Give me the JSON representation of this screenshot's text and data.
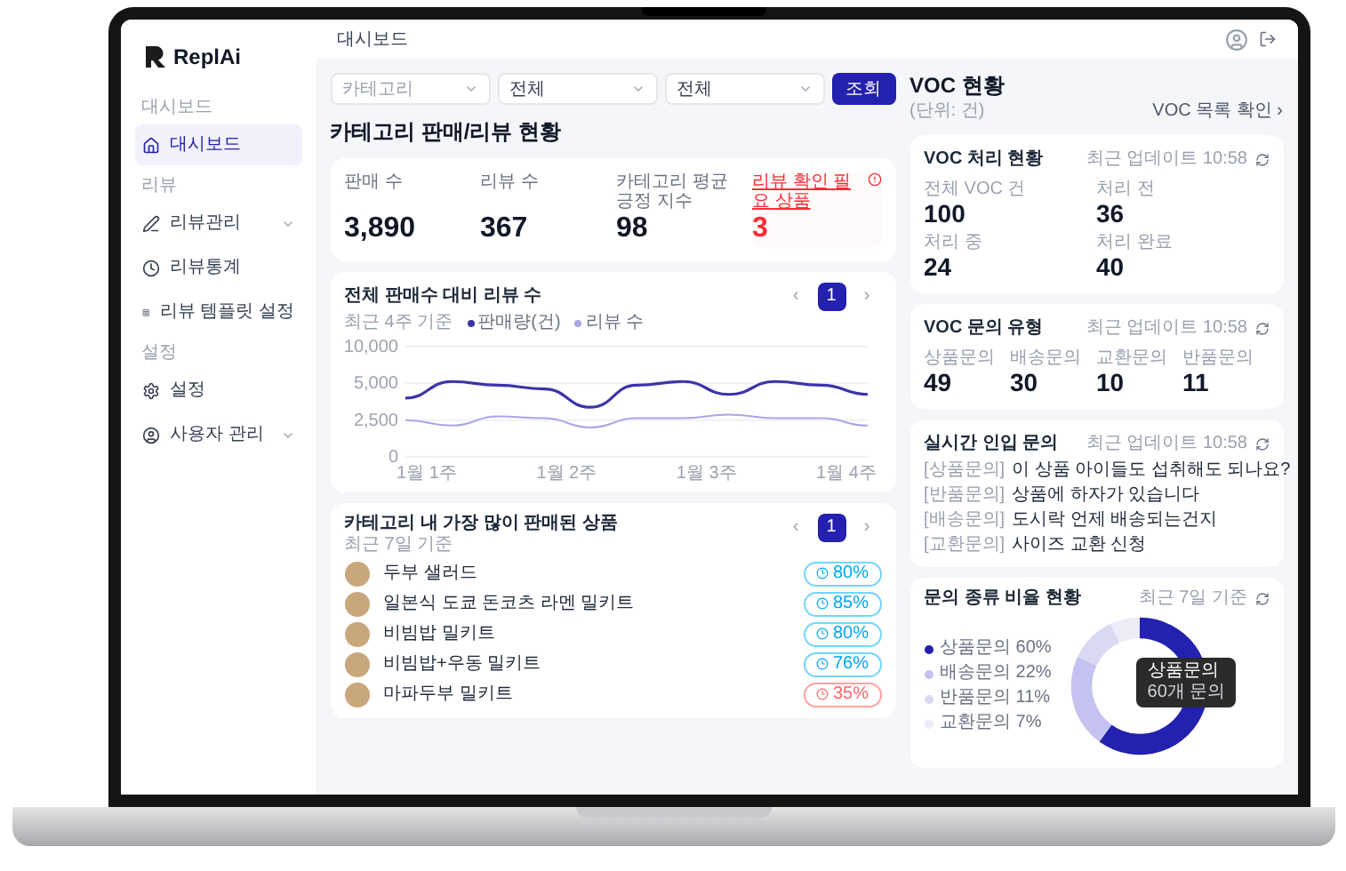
{
  "sidebar": {
    "logo": "ReplAi",
    "sections": [
      {
        "heading": "대시보드",
        "items": [
          {
            "label": "대시보드",
            "kind": "home",
            "selected": true,
            "expandable": false
          }
        ]
      },
      {
        "heading": "리뷰",
        "items": [
          {
            "label": "리뷰관리",
            "kind": "pen",
            "selected": false,
            "expandable": true
          },
          {
            "label": "리뷰통계",
            "kind": "clock",
            "selected": false,
            "expandable": false
          },
          {
            "label": "리뷰 템플릿 설정",
            "kind": "template",
            "selected": false,
            "expandable": false
          }
        ]
      },
      {
        "heading": "설정",
        "items": [
          {
            "label": "설정",
            "kind": "settings",
            "selected": false,
            "expandable": false
          },
          {
            "label": "사용자 관리",
            "kind": "user",
            "selected": false,
            "expandable": true
          }
        ]
      }
    ]
  },
  "header": {
    "breadcrumb": "대시보드"
  },
  "filters": {
    "selects": [
      {
        "placeholder": "카테고리"
      },
      {
        "value": "전체"
      },
      {
        "value": "전체"
      }
    ],
    "button": "조회"
  },
  "category_section": {
    "title": "카테고리 판매/리뷰 현황",
    "stats": [
      {
        "label": "판매 수",
        "value": "3,890",
        "alert": false
      },
      {
        "label": "리뷰 수",
        "value": "367",
        "alert": false
      },
      {
        "label": "카테고리 평균 긍정 지수",
        "value": "98",
        "alert": false
      },
      {
        "label": "리뷰 확인 필요 상품",
        "value": "3",
        "alert": true
      }
    ],
    "chart_card": {
      "title": "전체 판매수 대비 리뷰 수",
      "subtitle": "최근 4주 기준",
      "pager": {
        "prev": "‹",
        "page": "1",
        "next": "›"
      },
      "legend": [
        {
          "name": "판매량(건)",
          "color": "#3b35a8"
        },
        {
          "name": "리뷰 수",
          "color": "#a9a6e6"
        }
      ],
      "y_axis_labels": [
        "10,000",
        "5,000",
        "2,500",
        "0"
      ],
      "x_axis_labels": [
        "1월 1주",
        "1월 2주",
        "1월 3주",
        "1월 4주"
      ]
    },
    "products_card": {
      "title": "카테고리 내 가장 많이 판매된 상품",
      "subtitle": "최근 7일 기준",
      "pager": {
        "prev": "‹",
        "page": "1",
        "next": "›"
      },
      "items": [
        {
          "name": "두부 샐러드",
          "badge": "80%",
          "alert": false
        },
        {
          "name": "일본식 도쿄 돈코츠 라멘 밀키트",
          "badge": "85%",
          "alert": false
        },
        {
          "name": "비빔밥 밀키트",
          "badge": "80%",
          "alert": false
        },
        {
          "name": "비빔밥+우동 밀키트",
          "badge": "76%",
          "alert": false
        },
        {
          "name": "마파두부 밀키트",
          "badge": "35%",
          "alert": true
        }
      ]
    }
  },
  "voc": {
    "title": "VOC 현황",
    "subtitle": "(단위: 건)",
    "link": "VOC 목록 확인 ›",
    "status_card": {
      "title": "VOC 처리 현황",
      "meta": "최근 업데이트 10:58",
      "stats": [
        {
          "label": "전체 VOC 건",
          "value": "100"
        },
        {
          "label": "처리 전",
          "value": "36"
        },
        {
          "label": "처리 중",
          "value": "24"
        },
        {
          "label": "처리 완료",
          "value": "40"
        }
      ]
    },
    "types_card": {
      "title": "VOC 문의 유형",
      "meta": "최근 업데이트 10:58",
      "stats": [
        {
          "label": "상품문의",
          "value": "49"
        },
        {
          "label": "배송문의",
          "value": "30"
        },
        {
          "label": "교환문의",
          "value": "10"
        },
        {
          "label": "반품문의",
          "value": "11"
        }
      ]
    },
    "live_card": {
      "title": "실시간 인입 문의",
      "meta": "최근 업데이트 10:58",
      "items": [
        {
          "tag": "[상품문의]",
          "text": "이 상품 아이들도 섭취해도 되나요?"
        },
        {
          "tag": "[반품문의]",
          "text": "상품에 하자가 있습니다"
        },
        {
          "tag": "[배송문의]",
          "text": "도시락 언제 배송되는건지"
        },
        {
          "tag": "[교환문의]",
          "text": "사이즈 교환 신청"
        }
      ]
    },
    "ratio_card": {
      "title": "문의 종류 비율 현황",
      "meta": "최근 7일 기준",
      "tooltip": {
        "title": "상품문의",
        "value": "60개 문의"
      },
      "chart_data": {
        "type": "donut",
        "categories": [
          "상품문의 60%",
          "배송문의 22%",
          "반품문의 11%",
          "교환문의 7%"
        ],
        "values": [
          60,
          22,
          11,
          7
        ],
        "legend": "left",
        "colors": [
          "#2420b0",
          "#c3c2f0",
          "#d9d9f3",
          "#ececf7"
        ]
      }
    }
  }
}
